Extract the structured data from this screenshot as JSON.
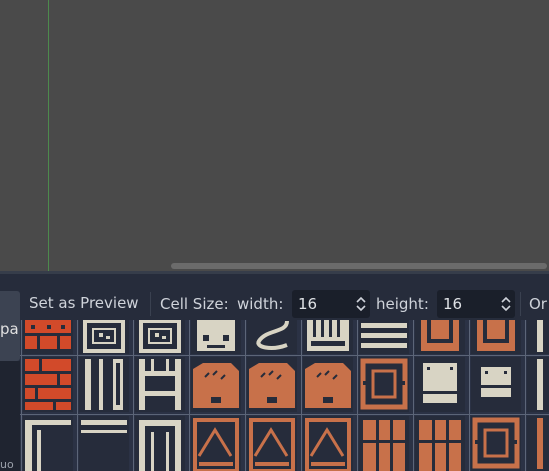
{
  "sidebar": {
    "tab_label": "par",
    "bottom_label": "uo"
  },
  "toolbar": {
    "preview_button": "Set as Preview",
    "cell_size_label": "Cell Size:",
    "width_label": "width:",
    "width_value": "16",
    "height_label": "height:",
    "height_value": "16",
    "overflow_label": "Or"
  },
  "tiles": [
    {
      "row": 0,
      "col": 0,
      "name": "tile-red-brick-top",
      "color": "#d24a2a",
      "pattern": "brick-top"
    },
    {
      "row": 0,
      "col": 1,
      "name": "tile-frame-dotted",
      "color": "#d8d4c4",
      "pattern": "frame"
    },
    {
      "row": 0,
      "col": 2,
      "name": "tile-frame-cracked",
      "color": "#d8d4c4",
      "pattern": "frame"
    },
    {
      "row": 0,
      "col": 3,
      "name": "tile-pillar-face",
      "color": "#d8d4c4",
      "pattern": "face"
    },
    {
      "row": 0,
      "col": 4,
      "name": "tile-pipe-curve",
      "color": "#d8d4c4",
      "pattern": "curve"
    },
    {
      "row": 0,
      "col": 5,
      "name": "tile-vent",
      "color": "#d8d4c4",
      "pattern": "vent"
    },
    {
      "row": 0,
      "col": 6,
      "name": "tile-stripes",
      "color": "#d8d4c4",
      "pattern": "stripes"
    },
    {
      "row": 0,
      "col": 7,
      "name": "tile-crate-bottom",
      "color": "#c8714a",
      "pattern": "crate-bottom"
    },
    {
      "row": 0,
      "col": 8,
      "name": "tile-crate-bottom-2",
      "color": "#c8714a",
      "pattern": "crate-bottom"
    },
    {
      "row": 0,
      "col": 9,
      "name": "tile-column-partial",
      "color": "#d8d4c4",
      "pattern": "column"
    },
    {
      "row": 1,
      "col": 0,
      "name": "tile-red-brick",
      "color": "#d24a2a",
      "pattern": "brick"
    },
    {
      "row": 1,
      "col": 1,
      "name": "tile-rails",
      "color": "#d8d4c4",
      "pattern": "rails"
    },
    {
      "row": 1,
      "col": 2,
      "name": "tile-ladder",
      "color": "#d8d4c4",
      "pattern": "ladder"
    },
    {
      "row": 1,
      "col": 3,
      "name": "tile-dirt-left",
      "color": "#c8714a",
      "pattern": "dirt"
    },
    {
      "row": 1,
      "col": 4,
      "name": "tile-dirt-mid",
      "color": "#c8714a",
      "pattern": "dirt"
    },
    {
      "row": 1,
      "col": 5,
      "name": "tile-dirt-right",
      "color": "#c8714a",
      "pattern": "dirt"
    },
    {
      "row": 1,
      "col": 6,
      "name": "tile-box-orange",
      "color": "#c8714a",
      "pattern": "box"
    },
    {
      "row": 1,
      "col": 7,
      "name": "tile-panel-light",
      "color": "#d8d4c4",
      "pattern": "panel"
    },
    {
      "row": 1,
      "col": 8,
      "name": "tile-panel-small",
      "color": "#d8d4c4",
      "pattern": "panel-small"
    },
    {
      "row": 1,
      "col": 9,
      "name": "tile-column-partial-2",
      "color": "#d8d4c4",
      "pattern": "column"
    },
    {
      "row": 2,
      "col": 0,
      "name": "tile-wall-corner",
      "color": "#d8d4c4",
      "pattern": "corner"
    },
    {
      "row": 2,
      "col": 1,
      "name": "tile-wall-top",
      "color": "#d8d4c4",
      "pattern": "wall-top"
    },
    {
      "row": 2,
      "col": 2,
      "name": "tile-door-frame",
      "color": "#d8d4c4",
      "pattern": "door"
    },
    {
      "row": 2,
      "col": 3,
      "name": "tile-arch-left",
      "color": "#c8714a",
      "pattern": "arch"
    },
    {
      "row": 2,
      "col": 4,
      "name": "tile-arch-mid",
      "color": "#c8714a",
      "pattern": "arch"
    },
    {
      "row": 2,
      "col": 5,
      "name": "tile-arch-right",
      "color": "#c8714a",
      "pattern": "arch"
    },
    {
      "row": 2,
      "col": 6,
      "name": "tile-planks",
      "color": "#c8714a",
      "pattern": "planks"
    },
    {
      "row": 2,
      "col": 7,
      "name": "tile-planks-2",
      "color": "#c8714a",
      "pattern": "planks"
    },
    {
      "row": 2,
      "col": 8,
      "name": "tile-box-frame",
      "color": "#c8714a",
      "pattern": "box"
    },
    {
      "row": 2,
      "col": 9,
      "name": "tile-column-partial-3",
      "color": "#c8714a",
      "pattern": "column"
    }
  ]
}
